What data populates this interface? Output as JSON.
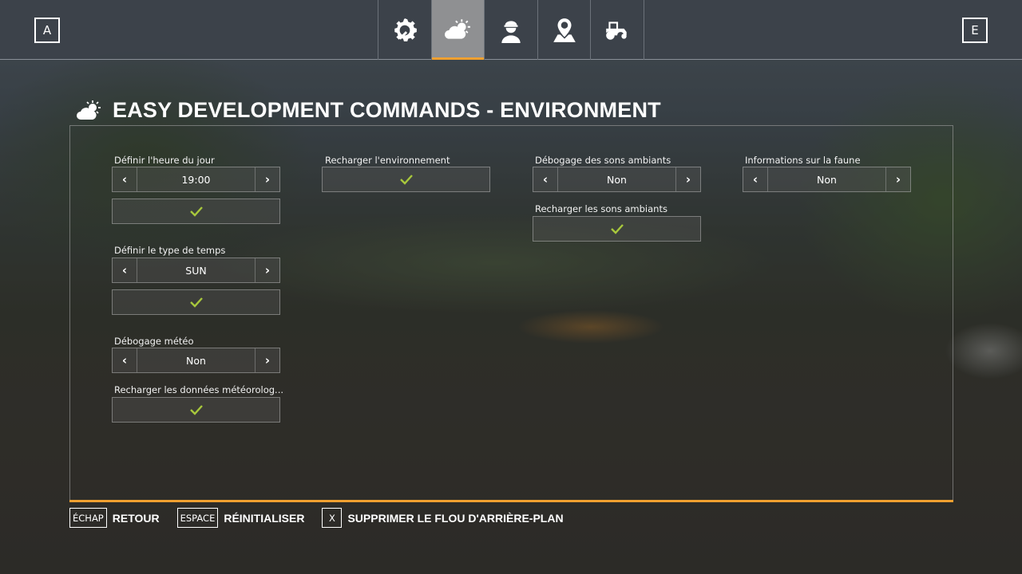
{
  "topbar": {
    "left_key": "A",
    "right_key": "E",
    "tabs": [
      {
        "icon": "wrench-gear-icon",
        "active": false
      },
      {
        "icon": "weather-icon",
        "active": true
      },
      {
        "icon": "farmer-icon",
        "active": false
      },
      {
        "icon": "map-pin-icon",
        "active": false
      },
      {
        "icon": "tractor-icon",
        "active": false
      }
    ]
  },
  "page": {
    "title": "EASY DEVELOPMENT COMMANDS - ENVIRONMENT",
    "title_icon": "weather-icon"
  },
  "settings": {
    "time_of_day": {
      "label": "Définir l'heure du jour",
      "value": "19:00"
    },
    "weather_type": {
      "label": "Définir le type de temps",
      "value": "SUN"
    },
    "weather_debug": {
      "label": "Débogage météo",
      "value": "Non"
    },
    "reload_weather": {
      "label": "Recharger les données météorolog..."
    },
    "reload_environment": {
      "label": "Recharger l'environnement"
    },
    "ambient_sound_debug": {
      "label": "Débogage des sons ambiants",
      "value": "Non"
    },
    "reload_ambient_sounds": {
      "label": "Recharger les sons ambiants"
    },
    "wildlife_info": {
      "label": "Informations sur la faune",
      "value": "Non"
    }
  },
  "footer": [
    {
      "key": "ÉCHAP",
      "label": "RETOUR"
    },
    {
      "key": "ESPACE",
      "label": "RÉINITIALISER"
    },
    {
      "key": "X",
      "label": "SUPPRIMER LE FLOU D'ARRIÈRE-PLAN"
    }
  ],
  "colors": {
    "accent": "#f0a030",
    "check": "#a8c83c"
  }
}
